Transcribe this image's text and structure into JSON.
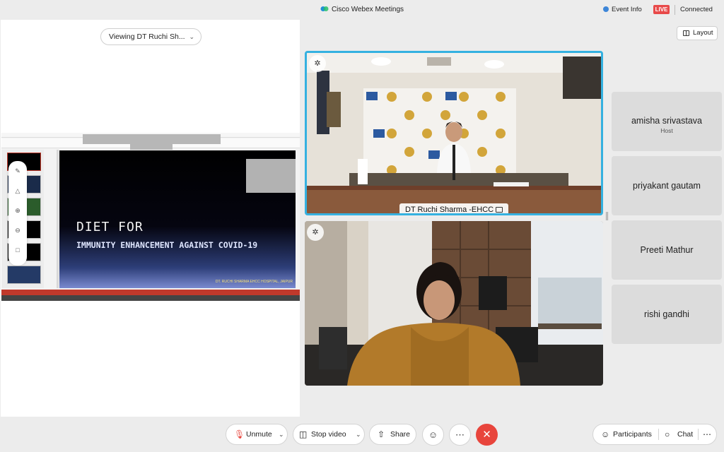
{
  "window": {
    "title": "Cisco Webex Meetings",
    "event_info": "Event Info",
    "live_badge": "LIVE",
    "connection_status": "Connected"
  },
  "share": {
    "viewing_label": "Viewing DT Ruchi Sh...",
    "slide": {
      "title_line1": "DIET FOR",
      "title_line2": "IMMUNITY ENHANCEMENT AGAINST COVID-19",
      "footer": "DT. RUCHI SHARMA EHCC HOSPITAL, JAIPUR"
    }
  },
  "layout_button": "Layout",
  "videos": {
    "active_speaker_name": "DT Ruchi Sharma -EHCC"
  },
  "participants": [
    {
      "name": "amisha srivastava",
      "role": "Host"
    },
    {
      "name": "priyakant gautam",
      "role": ""
    },
    {
      "name": "Preeti Mathur",
      "role": ""
    },
    {
      "name": "rishi gandhi",
      "role": ""
    }
  ],
  "toolbar": {
    "unmute": "Unmute",
    "stop_video": "Stop video",
    "share": "Share",
    "participants": "Participants",
    "chat": "Chat"
  },
  "colors": {
    "active_speaker_border": "#35b1e0",
    "end_call": "#e8453c",
    "live": "#e84a4a",
    "event_info_dot": "#3d86d8"
  },
  "icons": [
    "webex-logo-icon",
    "pin-icon",
    "layout-icon",
    "mic-muted-icon",
    "camera-icon",
    "share-icon",
    "reactions-icon",
    "more-icon",
    "end-call-icon",
    "participants-icon",
    "chat-icon",
    "chevron-down-icon"
  ]
}
